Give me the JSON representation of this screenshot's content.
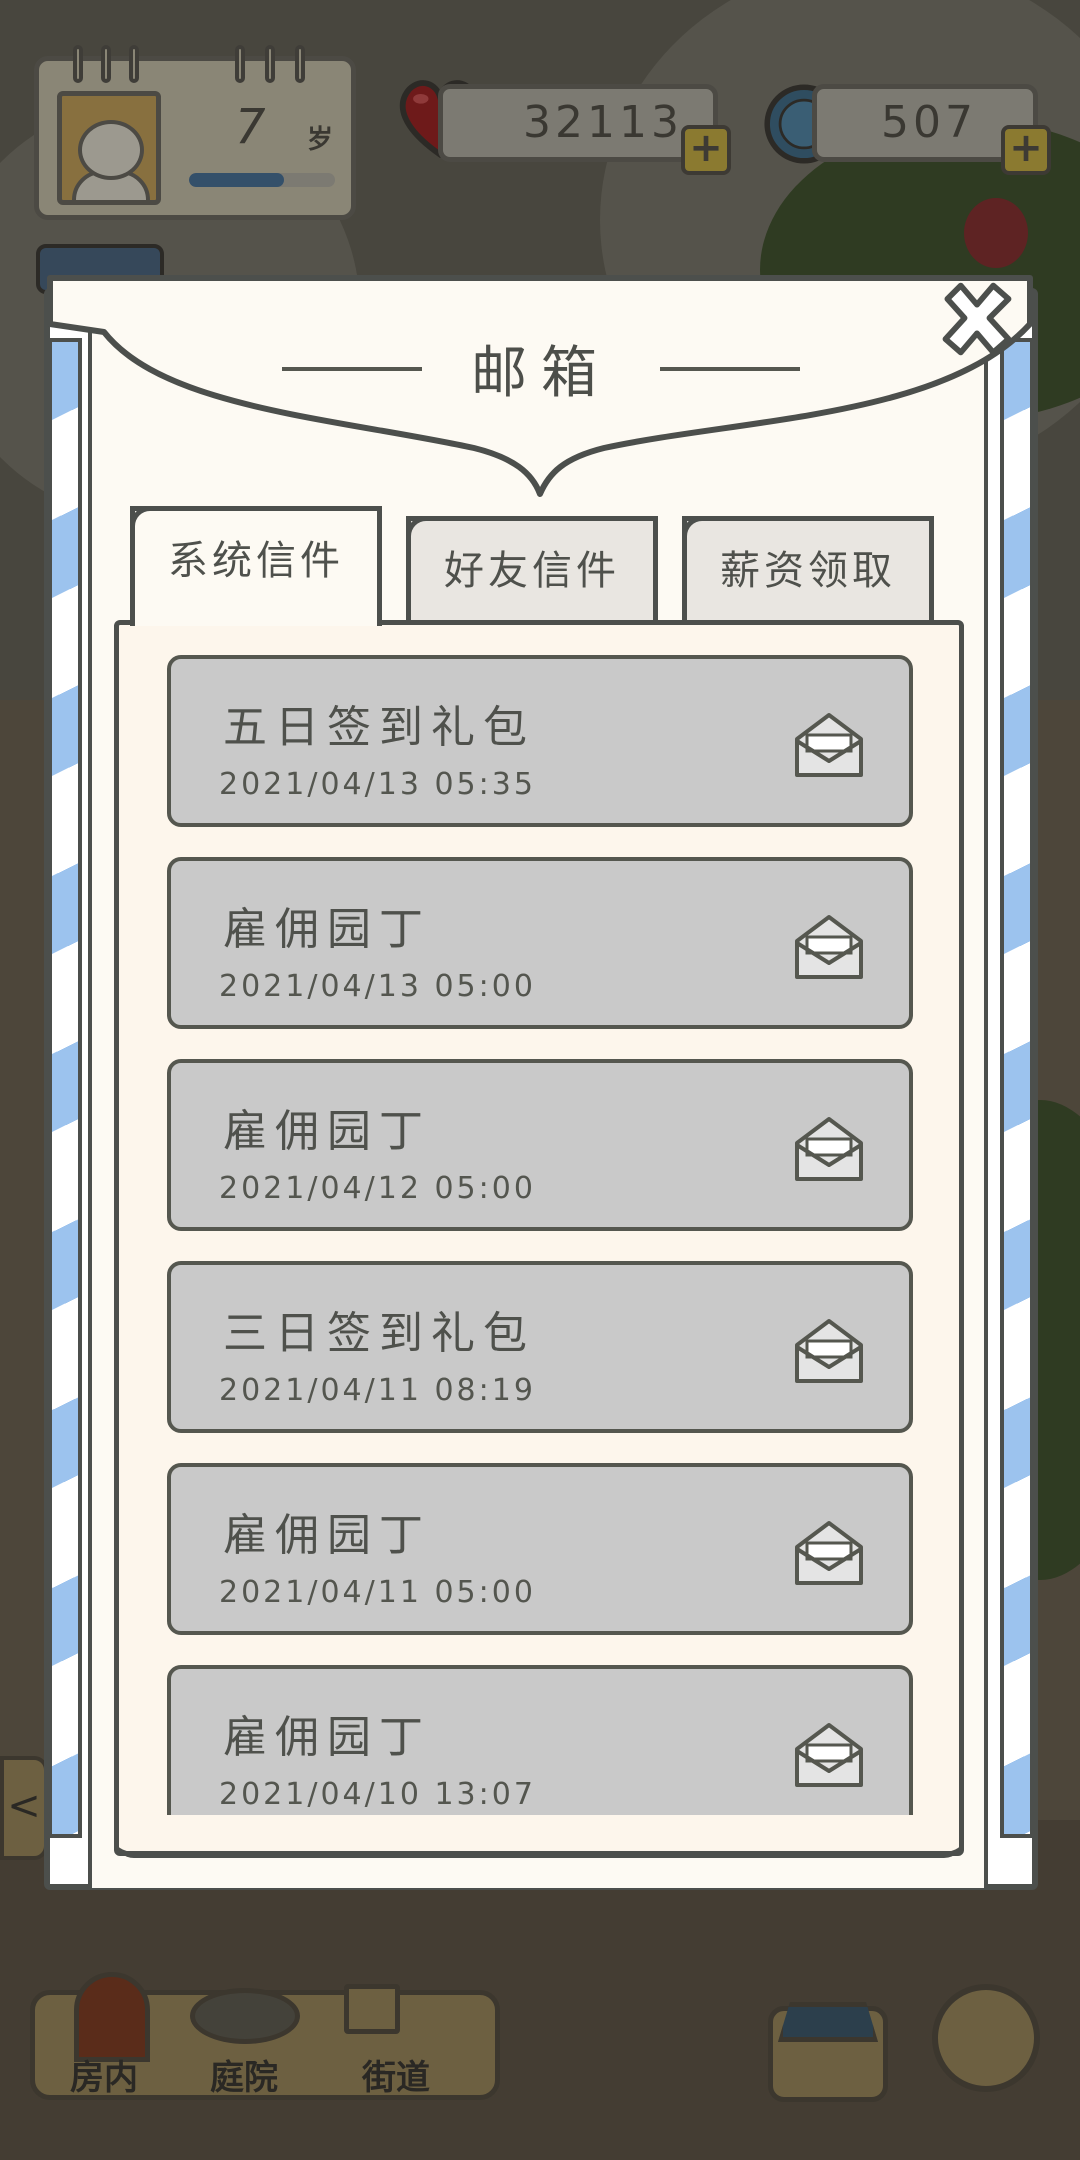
{
  "hud": {
    "age_value": "7",
    "age_unit": "岁",
    "age_progress": 0.65,
    "hearts": "32113",
    "bottle_caps": "507",
    "plus_label": "+"
  },
  "modal": {
    "title": "邮箱",
    "tabs": [
      {
        "label": "系统信件",
        "active": true
      },
      {
        "label": "好友信件",
        "active": false
      },
      {
        "label": "薪资领取",
        "active": false
      }
    ],
    "mails": [
      {
        "title": "五日签到礼包",
        "time": "2021/04/13 05:35"
      },
      {
        "title": "雇佣园丁",
        "time": "2021/04/13 05:00"
      },
      {
        "title": "雇佣园丁",
        "time": "2021/04/12 05:00"
      },
      {
        "title": "三日签到礼包",
        "time": "2021/04/11 08:19"
      },
      {
        "title": "雇佣园丁",
        "time": "2021/04/11 05:00"
      },
      {
        "title": "雇佣园丁",
        "time": "2021/04/10 13:07"
      }
    ]
  },
  "nav": {
    "items": [
      "房内",
      "庭院",
      "街道"
    ],
    "back_arrow": "<"
  },
  "colors": {
    "stripe_blue": "#9cc3ee",
    "mail_bg": "#c9c9c9",
    "paper": "#fdf6ec"
  }
}
